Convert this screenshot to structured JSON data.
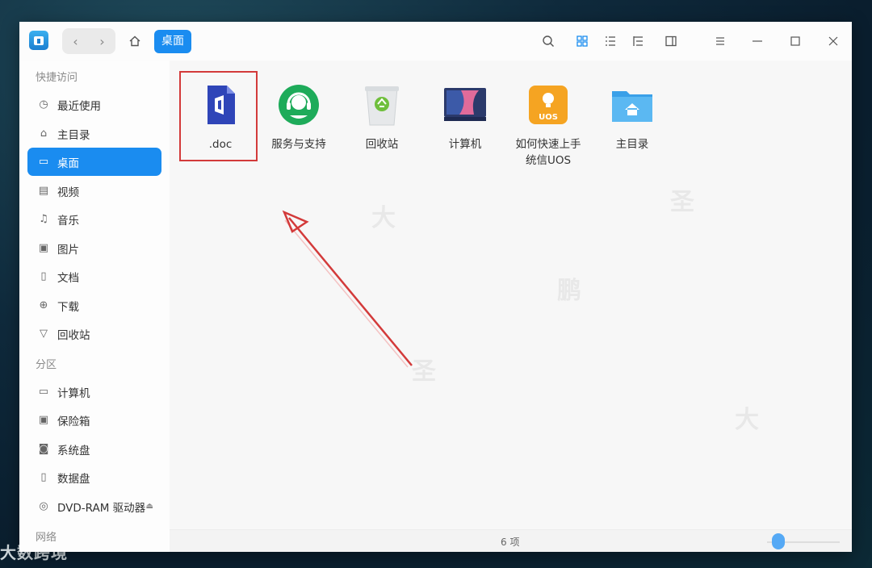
{
  "titlebar": {
    "breadcrumb_active": "桌面"
  },
  "sidebar": {
    "sections": {
      "quick_access": "快捷访问",
      "partitions": "分区",
      "network": "网络"
    },
    "items": [
      {
        "label": "最近使用",
        "icon": "clock-icon"
      },
      {
        "label": "主目录",
        "icon": "home-icon"
      },
      {
        "label": "桌面",
        "icon": "desktop-icon",
        "active": true
      },
      {
        "label": "视频",
        "icon": "video-icon"
      },
      {
        "label": "音乐",
        "icon": "music-icon"
      },
      {
        "label": "图片",
        "icon": "image-icon"
      },
      {
        "label": "文档",
        "icon": "document-icon"
      },
      {
        "label": "下载",
        "icon": "download-icon"
      },
      {
        "label": "回收站",
        "icon": "trash-icon"
      }
    ],
    "partitions": [
      {
        "label": "计算机",
        "icon": "computer-icon"
      },
      {
        "label": "保险箱",
        "icon": "safe-icon"
      },
      {
        "label": "系统盘",
        "icon": "disk-icon"
      },
      {
        "label": "数据盘",
        "icon": "disk-icon"
      },
      {
        "label": "DVD-RAM 驱动器",
        "icon": "dvd-icon"
      }
    ]
  },
  "files": [
    {
      "label": ".doc",
      "icon": "office-doc-icon"
    },
    {
      "label": "服务与支持",
      "icon": "support-icon"
    },
    {
      "label": "回收站",
      "icon": "recycle-bin-icon"
    },
    {
      "label": "计算机",
      "icon": "computer-icon"
    },
    {
      "label": "如何快速上手统信UOS",
      "icon": "uos-guide-icon"
    },
    {
      "label": "主目录",
      "icon": "home-folder-icon"
    }
  ],
  "status": {
    "count": "6 项"
  },
  "watermark": {
    "bottom_left": "大数跨境"
  },
  "colors": {
    "accent": "#1a8cf0",
    "highlight": "#d33a3a"
  }
}
